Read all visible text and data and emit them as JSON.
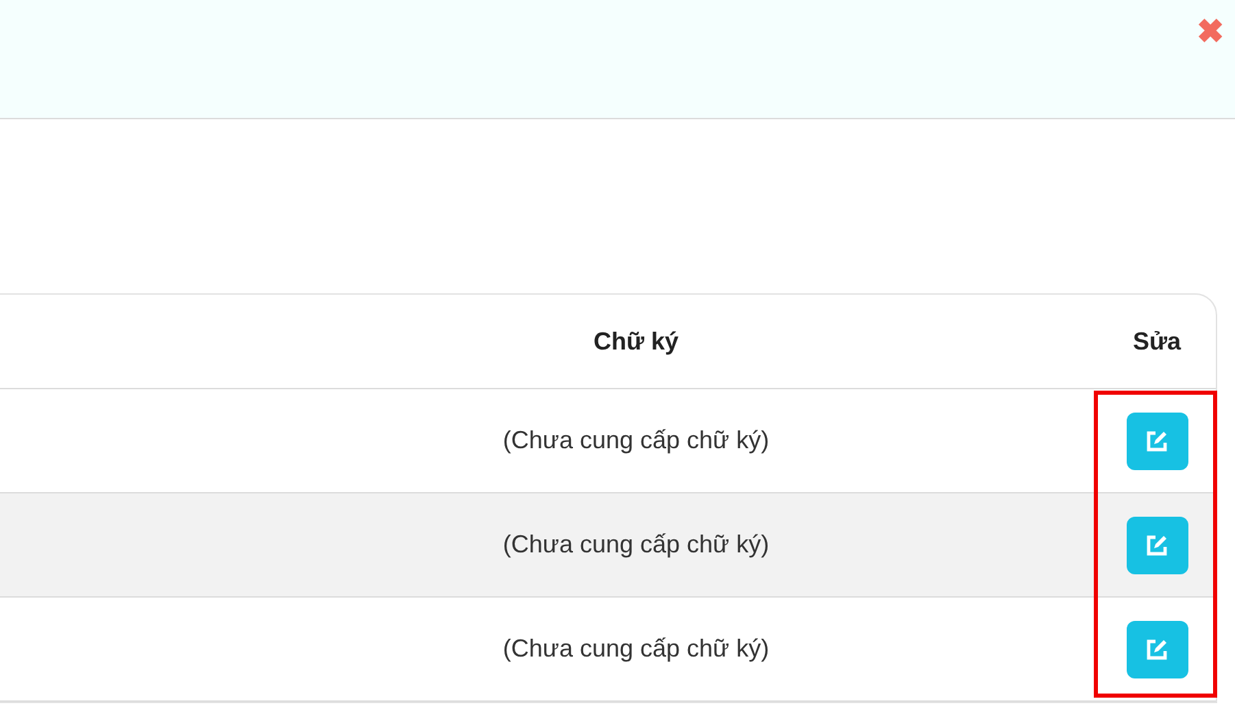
{
  "dialog": {
    "close_label": "✖"
  },
  "table": {
    "columns": [
      "Chữ ký",
      "Sửa"
    ],
    "rows": [
      {
        "signature": "(Chưa cung cấp chữ ký)"
      },
      {
        "signature": "(Chưa cung cấp chữ ký)"
      },
      {
        "signature": "(Chưa cung cấp chữ ký)"
      }
    ]
  }
}
